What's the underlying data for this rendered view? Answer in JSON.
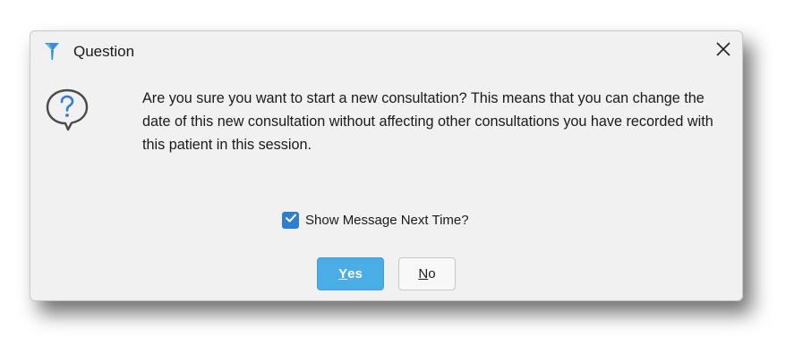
{
  "dialog": {
    "title": "Question",
    "message": "Are you sure you want to start a new consultation? This means that you can change the date of this new consultation without affecting other consultations you have recorded with this patient in this session.",
    "checkbox": {
      "label": "Show Message Next Time?",
      "checked": true
    },
    "buttons": {
      "yes": {
        "mnemonic": "Y",
        "rest": "es"
      },
      "no": {
        "mnemonic": "N",
        "rest": "o"
      }
    },
    "icons": {
      "app": "app-logo-icon",
      "close": "close-icon",
      "question": "question-bubble-icon",
      "check": "checkmark-icon"
    },
    "colors": {
      "accent": "#4bade5",
      "checkbox": "#2f7fd1",
      "dialog_bg": "#f1f1f1"
    }
  }
}
